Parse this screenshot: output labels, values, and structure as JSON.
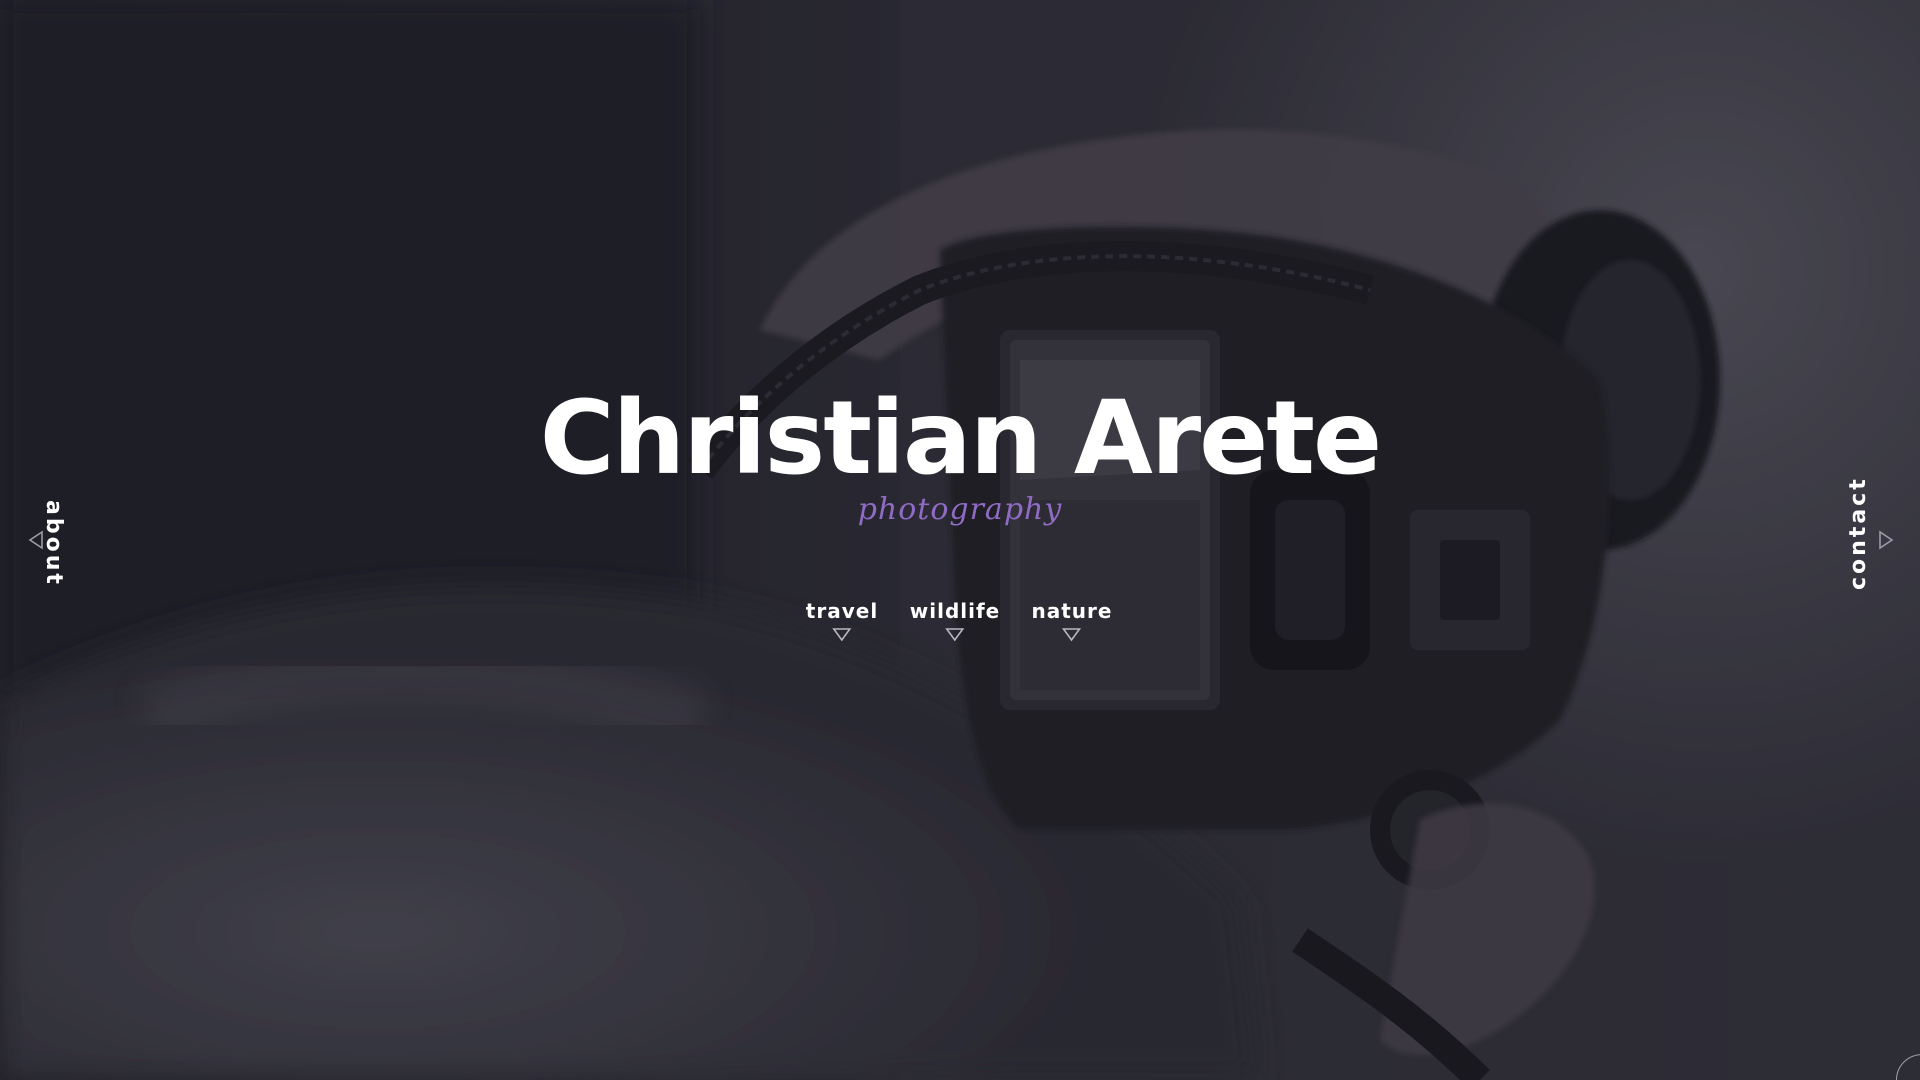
{
  "hero": {
    "title": "Christian Arete",
    "subtitle": "photography"
  },
  "categories": [
    {
      "label": "travel"
    },
    {
      "label": "wildlife"
    },
    {
      "label": "nature"
    }
  ],
  "side_nav": {
    "left": {
      "label": "about",
      "icon": "triangle-left-icon"
    },
    "right": {
      "label": "contact",
      "icon": "triangle-right-icon"
    }
  },
  "colors": {
    "accent": "#8f6bc4",
    "text": "#ffffff",
    "overlay": "#24232c"
  }
}
